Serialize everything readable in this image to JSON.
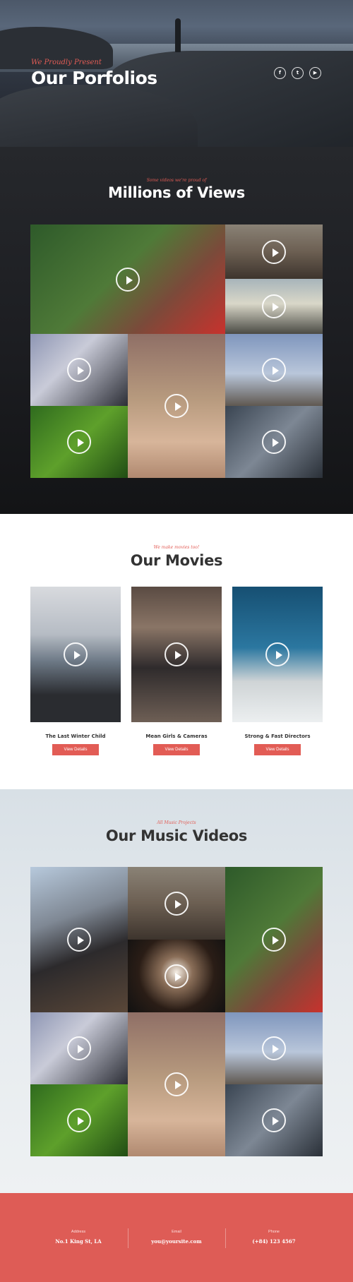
{
  "hero": {
    "kicker": "We Proudly Present",
    "title": "Our Porfolios",
    "social": [
      {
        "icon": "facebook-icon",
        "glyph": "f"
      },
      {
        "icon": "twitter-icon",
        "glyph": "t"
      },
      {
        "icon": "youtube-icon",
        "glyph": "▶"
      }
    ]
  },
  "views": {
    "kicker": "Some videos we're proud of",
    "title": "Millions of Views"
  },
  "movies": {
    "kicker": "We make movies too!",
    "title": "Our Movies",
    "items": [
      {
        "name": "The Last Winter Child",
        "button": "View Details"
      },
      {
        "name": "Mean Girls & Cameras",
        "button": "View Details"
      },
      {
        "name": "Strong & Fast Directors",
        "button": "View Details"
      }
    ]
  },
  "music": {
    "kicker": "All Music Projects",
    "title": "Our Music Videos"
  },
  "footer": {
    "address_label": "Address",
    "address_value": "No.1 King St, LA",
    "email_label": "Email",
    "email_value": "you@yoursite.com",
    "phone_label": "Phone",
    "phone_value": "(+84) 123 4567"
  },
  "colors": {
    "accent": "#e25c55",
    "dark": "#1c1d21",
    "footer_bg": "#de5c56"
  }
}
